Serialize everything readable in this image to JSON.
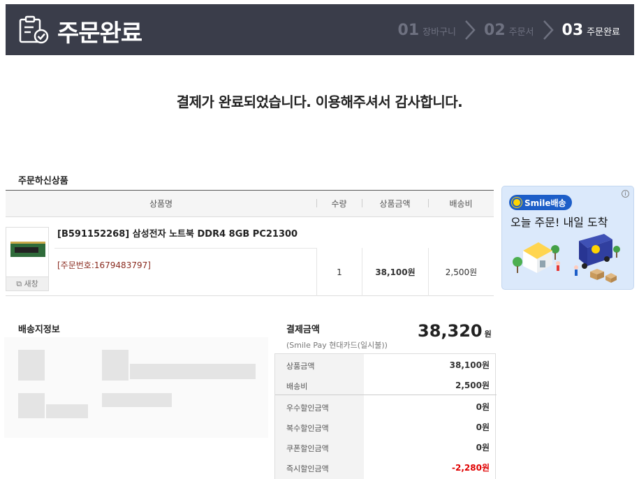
{
  "header": {
    "title": "주문완료",
    "steps": [
      {
        "num": "01",
        "label": "장바구니"
      },
      {
        "num": "02",
        "label": "주문서"
      },
      {
        "num": "03",
        "label": "주문완료"
      }
    ]
  },
  "message": "결제가 완료되었습니다. 이용해주셔서 감사합니다.",
  "ordered_products": {
    "title": "주문하신상품",
    "columns": [
      "상품명",
      "수량",
      "상품금액",
      "배송비"
    ],
    "item": {
      "name": "[B591152268] 삼성전자 노트북 DDR4 8GB PC21300",
      "order_number": "[주문번호:1679483797]",
      "quantity": "1",
      "amount": "38,100원",
      "shipping": "2,500원",
      "new_window_label": "새창"
    }
  },
  "ad": {
    "badge": "Smile배송",
    "tagline": "오늘 주문! 내일 도착",
    "info": "i"
  },
  "delivery": {
    "title": "배송지정보"
  },
  "payment": {
    "title": "결제금액",
    "method": "(Smile Pay 현대카드(일시불))",
    "total": "38,320",
    "total_unit": "원",
    "rows": [
      {
        "label": "상품금액",
        "value": "38,100원"
      },
      {
        "label": "배송비",
        "value": "2,500원"
      },
      {
        "label": "우수할인금액",
        "value": "0원"
      },
      {
        "label": "복수할인금액",
        "value": "0원"
      },
      {
        "label": "쿠폰할인금액",
        "value": "0원"
      },
      {
        "label": "즉시할인금액",
        "value": "-2,280원"
      }
    ]
  },
  "colors": {
    "header_bg": "#3a3d4a",
    "step_inactive": "#6e7180",
    "order_number": "#8a2b1f",
    "negative": "#e00000",
    "smile_blue": "#1d5ec8"
  }
}
